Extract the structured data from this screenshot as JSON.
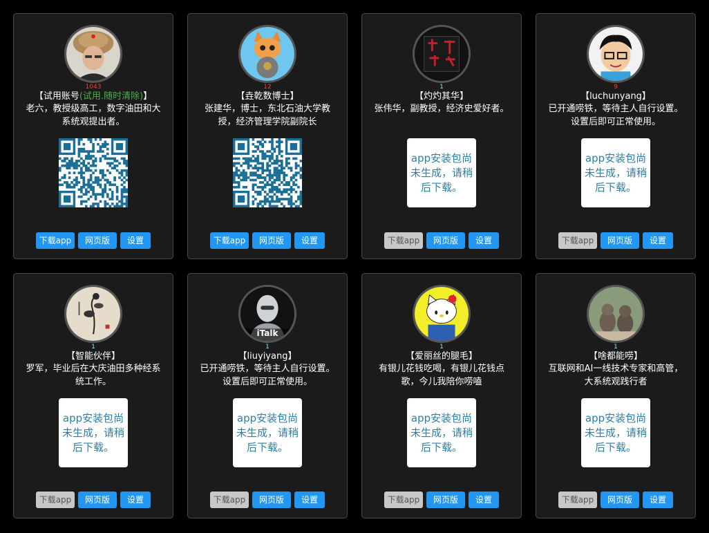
{
  "labels": {
    "download": "下载app",
    "web": "网页版",
    "settings": "设置",
    "no_package": "app安装包尚未生成，请稍后下载。"
  },
  "colors": {
    "count_red": "#ff3b30",
    "count_cyan": "#7fe7ff",
    "trial_green": "#4caf50",
    "button_blue": "#2196f3",
    "button_disabled": "#c8c8c8"
  },
  "cards": [
    {
      "count": "1043",
      "count_color": "red",
      "name_prefix": "【试用账号",
      "name_trial": "(试用.随时清除)",
      "name_suffix": "】",
      "desc": "老六，教授级高工，数字油田和大系统观提出者。",
      "avatar": "man-fur-hat-avatar",
      "has_qr": true,
      "download_enabled": true
    },
    {
      "count": "12",
      "count_color": "red",
      "name": "【垚乾数博士】",
      "desc": "张建华，博士，东北石油大学教授，经济管理学院副院长",
      "avatar": "cartoon-cat-avatar",
      "has_qr": true,
      "download_enabled": true
    },
    {
      "count": "1",
      "count_color": "cyan",
      "name": "【灼灼其华】",
      "desc": "张伟华，副教授，经济史爱好者。",
      "avatar": "red-calligraphy-avatar",
      "has_qr": false,
      "download_enabled": false
    },
    {
      "count": "9",
      "count_color": "red",
      "name": "【luchunyang】",
      "desc": "已开通唠铁，等待主人自行设置。设置后即可正常使用。",
      "avatar": "cartoon-boy-glasses-avatar",
      "has_qr": false,
      "download_enabled": false
    },
    {
      "count": "1",
      "count_color": "cyan",
      "name": "【智能伙伴】",
      "desc": "罗军，毕业后在大庆油田多种经系统工作。",
      "avatar": "ink-flower-painting-avatar",
      "has_qr": false,
      "download_enabled": false
    },
    {
      "count": "1",
      "count_color": "cyan",
      "name": "【liuyiyang】",
      "desc": "已开通唠铁，等待主人自行设置。设置后即可正常使用。",
      "avatar": "robot-avatar",
      "avatar_text": "iTalk",
      "has_qr": false,
      "download_enabled": false
    },
    {
      "count": "1",
      "count_color": "cyan",
      "name": "【爱丽丝的腿毛】",
      "desc": "有银儿花钱吃喝，有银儿花钱点歌，今儿我陪你唠嗑",
      "avatar": "hello-kitty-avatar",
      "has_qr": false,
      "download_enabled": false
    },
    {
      "count": "1",
      "count_color": "cyan",
      "name": "【啥都能唠】",
      "desc": "互联网和AI一线技术专家和高管，大系统观践行者",
      "avatar": "two-cats-window-avatar",
      "has_qr": false,
      "download_enabled": false
    }
  ]
}
